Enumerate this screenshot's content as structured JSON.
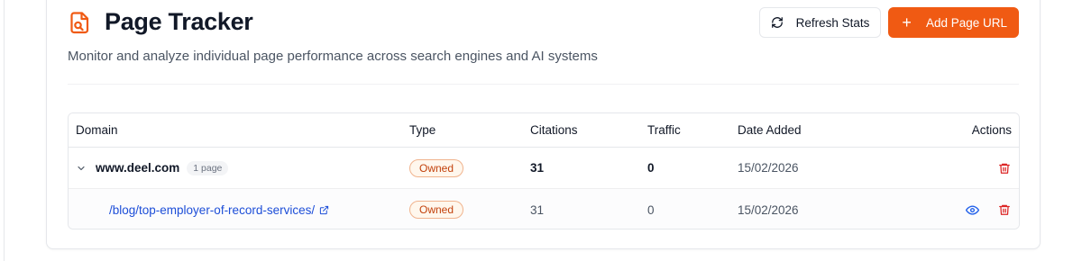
{
  "header": {
    "title": "Page Tracker",
    "subtitle": "Monitor and analyze individual page performance across search engines and AI systems",
    "accent_color": "#f05a13",
    "icon": "page-tracker-icon"
  },
  "toolbar": {
    "refresh_label": "Refresh Stats",
    "refresh_icon": "refresh-icon",
    "add_label": "Add Page URL",
    "add_icon": "plus-icon"
  },
  "table": {
    "columns": {
      "domain": "Domain",
      "type": "Type",
      "citations": "Citations",
      "traffic": "Traffic",
      "date_added": "Date Added",
      "actions": "Actions"
    },
    "domain_row": {
      "domain": "www.deel.com",
      "page_count": "1 page",
      "type": "Owned",
      "citations": "31",
      "traffic": "0",
      "date_added": "15/02/2026",
      "expanded": true
    },
    "page_row": {
      "path": "/blog/top-employer-of-record-services/",
      "type": "Owned",
      "citations": "31",
      "traffic": "0",
      "date_added": "15/02/2026"
    }
  }
}
